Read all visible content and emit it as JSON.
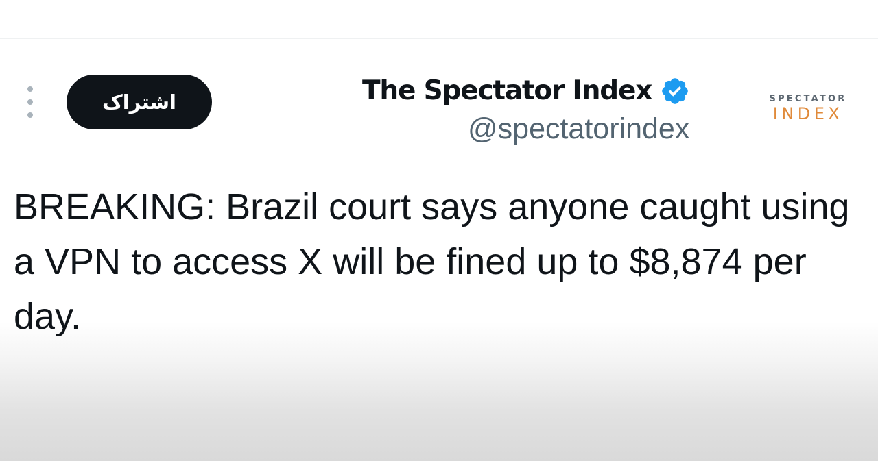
{
  "header": {
    "subscribe_label": "اشتراک",
    "display_name": "The Spectator Index",
    "handle": "@spectatorindex",
    "verified": true,
    "verified_color": "#1d9bf0",
    "more_icon": "more-vertical-icon"
  },
  "logo": {
    "line1": "SPECTATOR",
    "line2": "INDEX",
    "accent_color": "#e08a3a"
  },
  "tweet": {
    "text": "BREAKING: Brazil court says anyone caught using a VPN to access X will be fined up to $8,874 per day."
  }
}
